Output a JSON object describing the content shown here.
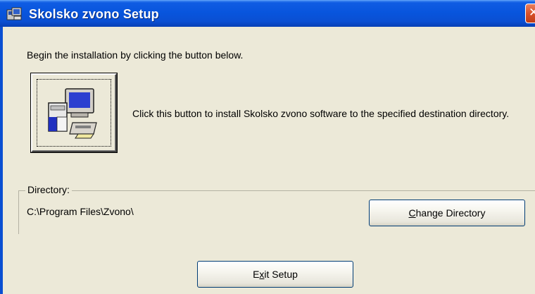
{
  "window": {
    "title": "Skolsko zvono Setup",
    "app_icon": "setup-computer-icon",
    "close_icon": "close-icon"
  },
  "content": {
    "intro_text": "Begin the installation by clicking the button below.",
    "install_button_icon": "install-computer-icon",
    "install_description": "Click this button to install Skolsko zvono software to the specified destination directory."
  },
  "directory": {
    "group_label": "Directory:",
    "path": "C:\\Program Files\\Zvono\\",
    "change_button": "Change Directory",
    "change_mnemonic": "C"
  },
  "exit_button": {
    "label": "Exit Setup",
    "mnemonic": "x"
  },
  "colors": {
    "titlebar": "#0a4fd2",
    "window_bg": "#ece9d8",
    "close_button": "#d8522b",
    "button_border": "#003c74"
  }
}
